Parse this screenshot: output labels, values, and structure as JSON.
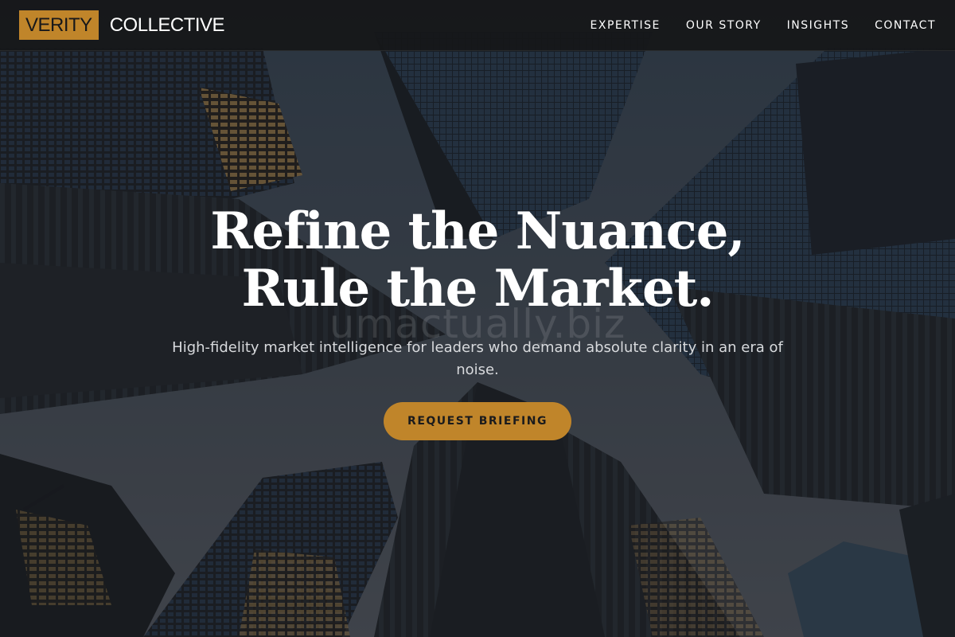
{
  "header": {
    "logo_primary": "VERITY",
    "logo_secondary": "COLLECTIVE",
    "nav": [
      {
        "label": "EXPERTISE"
      },
      {
        "label": "OUR STORY"
      },
      {
        "label": "INSIGHTS"
      },
      {
        "label": "CONTACT"
      }
    ]
  },
  "hero": {
    "title": "Refine the Nuance, Rule the Market.",
    "subtitle": "High-fidelity market intelligence for leaders who demand absolute clarity in an era of noise.",
    "cta_label": "REQUEST BRIEFING",
    "watermark": "umactually.biz",
    "background_image": "city-skyscrapers-looking-up"
  },
  "colors": {
    "accent": "#c0852a",
    "header_bg": "#161719",
    "text_light": "#ffffff"
  }
}
